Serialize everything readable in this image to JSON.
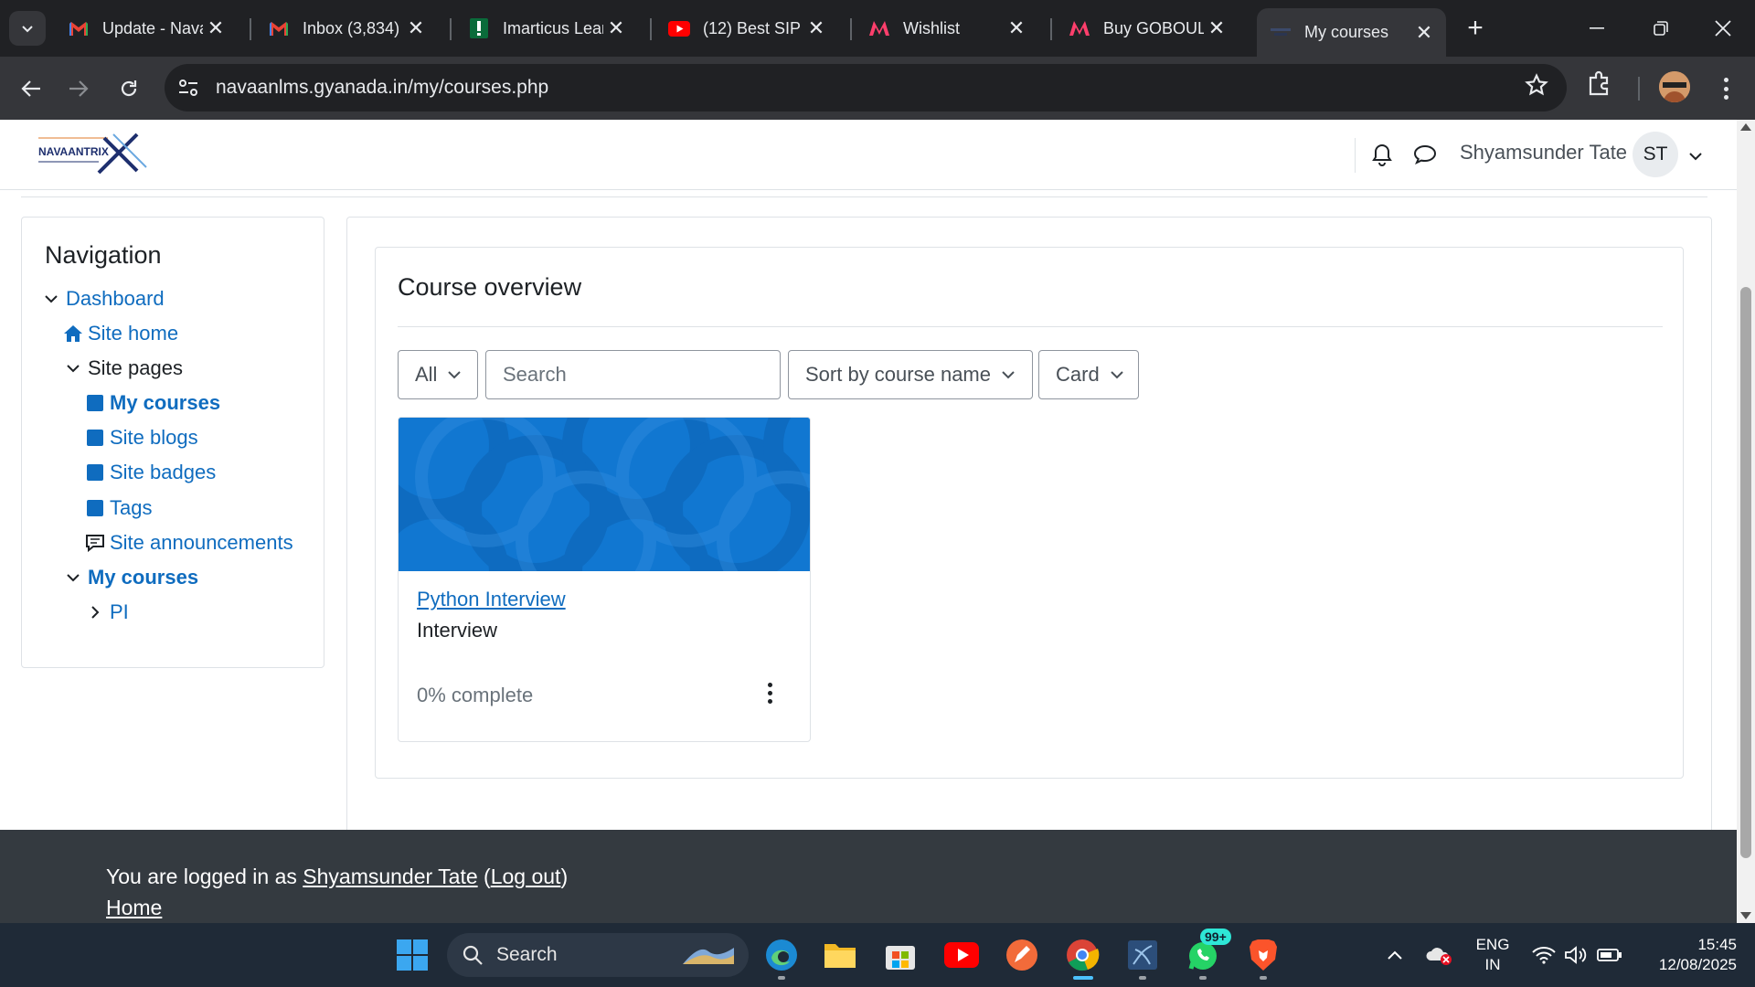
{
  "browser": {
    "tabs": [
      {
        "title": "Update - Nava",
        "favicon": "gmail-icon",
        "active": false
      },
      {
        "title": "Inbox (3,834)",
        "favicon": "gmail-icon",
        "active": false
      },
      {
        "title": "Imarticus Lear",
        "favicon": "imarticus-icon",
        "active": false
      },
      {
        "title": "(12) Best SIP P",
        "favicon": "youtube-icon",
        "active": false
      },
      {
        "title": "Wishlist",
        "favicon": "myntra-icon",
        "active": false
      },
      {
        "title": "Buy GOBOULT",
        "favicon": "myntra-icon",
        "active": false
      },
      {
        "title": "My courses",
        "favicon": "moodle-icon",
        "active": true
      }
    ],
    "url": "navaanlms.gyanada.in/my/courses.php"
  },
  "header": {
    "logo_text": "NAVAANTRIX",
    "user_name": "Shyamsunder Tate",
    "avatar_initials": "ST"
  },
  "navigation": {
    "title": "Navigation",
    "items": [
      {
        "label": "Dashboard"
      },
      {
        "label": "Site home"
      },
      {
        "label": "Site pages"
      },
      {
        "label": "My courses"
      },
      {
        "label": "Site blogs"
      },
      {
        "label": "Site badges"
      },
      {
        "label": "Tags"
      },
      {
        "label": "Site announcements"
      },
      {
        "label": "My courses"
      },
      {
        "label": "PI"
      }
    ]
  },
  "course_overview": {
    "title": "Course overview",
    "filter_value": "All",
    "search_placeholder": "Search",
    "sort_value": "Sort by course name",
    "view_value": "Card",
    "courses": [
      {
        "name": "Python Interview",
        "category": "Interview",
        "progress_text": "0% complete",
        "progress": 0
      }
    ]
  },
  "footer": {
    "logged_in_prefix": "You are logged in as ",
    "user_link": "Shyamsunder Tate",
    "open_paren": " (",
    "logout_link": "Log out",
    "close_paren": ")",
    "home_link": "Home"
  },
  "taskbar": {
    "search_label": "Search",
    "whatsapp_badge": "99+",
    "language": "ENG",
    "region": "IN",
    "time": "15:45",
    "date": "12/08/2025"
  },
  "colors": {
    "link": "#0f6cbf",
    "footer_bg": "#343a40",
    "course_image": "#1177d1"
  }
}
